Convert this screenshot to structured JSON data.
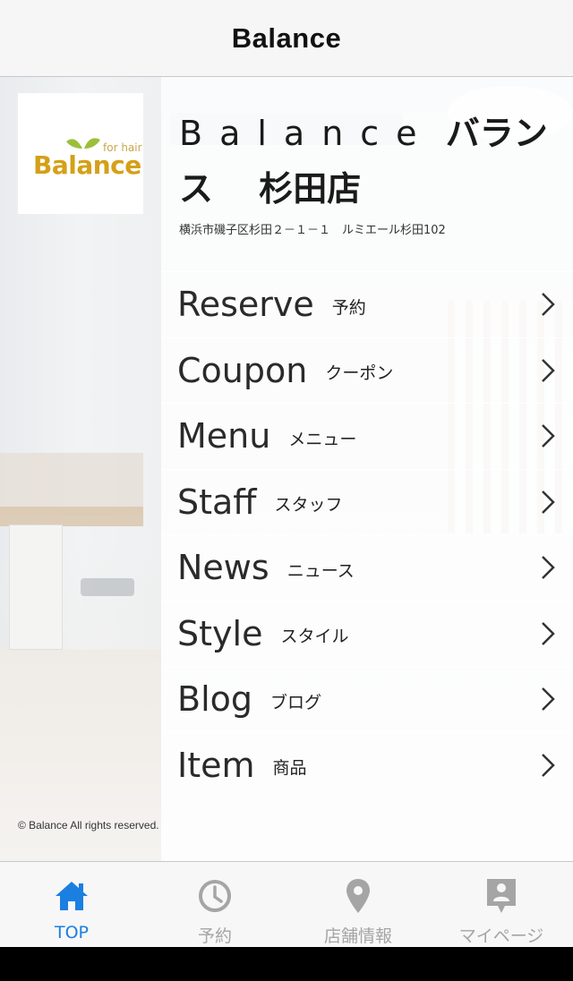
{
  "navbar": {
    "title": "Balance"
  },
  "logo": {
    "sub": "for hair",
    "text": "Balance"
  },
  "shop": {
    "name_roman": "Balance",
    "name_kana": "バランス",
    "branch": "杉田店",
    "address": "横浜市磯子区杉田２－１－１　ルミエール杉田102"
  },
  "menu": [
    {
      "en": "Reserve",
      "ja": "予約"
    },
    {
      "en": "Coupon",
      "ja": "クーポン"
    },
    {
      "en": "Menu",
      "ja": "メニュー"
    },
    {
      "en": "Staff",
      "ja": "スタッフ"
    },
    {
      "en": "News",
      "ja": "ニュース"
    },
    {
      "en": "Style",
      "ja": "スタイル"
    },
    {
      "en": "Blog",
      "ja": "ブログ"
    },
    {
      "en": "Item",
      "ja": "商品"
    }
  ],
  "copyright": "© Balance All rights reserved.",
  "tabs": [
    {
      "label": "TOP",
      "icon": "home-icon",
      "active": true
    },
    {
      "label": "予約",
      "icon": "clock-icon",
      "active": false
    },
    {
      "label": "店舗情報",
      "icon": "map-pin-icon",
      "active": false
    },
    {
      "label": "マイページ",
      "icon": "user-badge-icon",
      "active": false
    }
  ],
  "colors": {
    "accent": "#1a7fe0",
    "inactive": "#a5a5a5",
    "logo": "#d4a017"
  }
}
